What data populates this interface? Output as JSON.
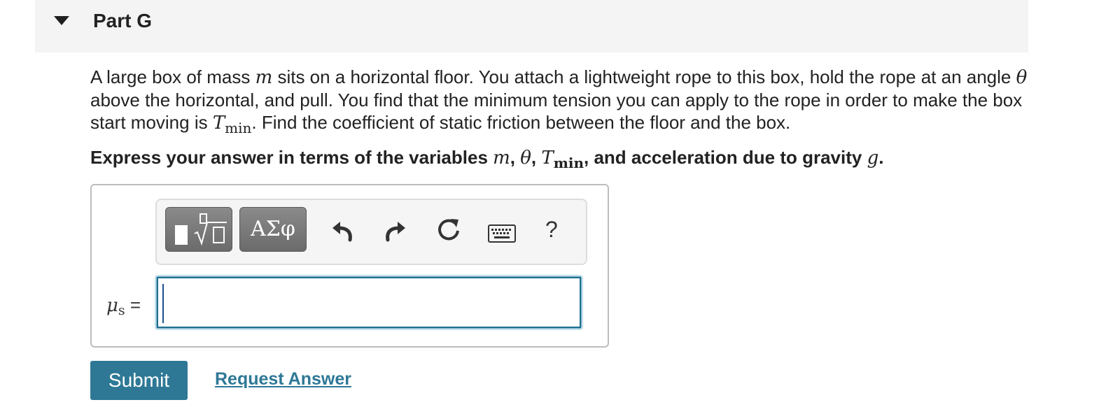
{
  "part": {
    "title": "Part G"
  },
  "problem": {
    "text_1": "A large box of mass ",
    "var_m": "m",
    "text_2": " sits on a horizontal floor. You attach a lightweight rope to this box, hold the rope at an angle ",
    "var_theta": "θ",
    "text_3": " above the horizontal, and pull. You find that the minimum tension you can apply to the rope in order to make the box start moving is ",
    "var_T": "T",
    "var_T_sub": "min",
    "text_4": ". Find the coefficient of static friction between the floor and the box."
  },
  "instruction": {
    "text_1": "Express your answer in terms of the variables ",
    "var_m": "m",
    "sep_1": ", ",
    "var_theta": "θ",
    "sep_2": ", ",
    "var_T": "T",
    "var_T_sub": "min",
    "text_2": ", and acceleration due to gravity ",
    "var_g": "g",
    "text_3": "."
  },
  "toolbar": {
    "greek_label": "ΑΣφ",
    "help_label": "?",
    "icons": [
      "templates-icon",
      "greek-symbols-icon",
      "undo-icon",
      "redo-icon",
      "reset-icon",
      "keyboard-icon",
      "help-icon"
    ]
  },
  "answer": {
    "mu_symbol": "μ",
    "mu_sub": "s",
    "equals": " =",
    "value": ""
  },
  "actions": {
    "submit_label": "Submit",
    "request_label": "Request Answer"
  },
  "colors": {
    "accent": "#2e7896",
    "header_bg": "#f4f4f4",
    "tool_button": "#7a7a7a"
  }
}
